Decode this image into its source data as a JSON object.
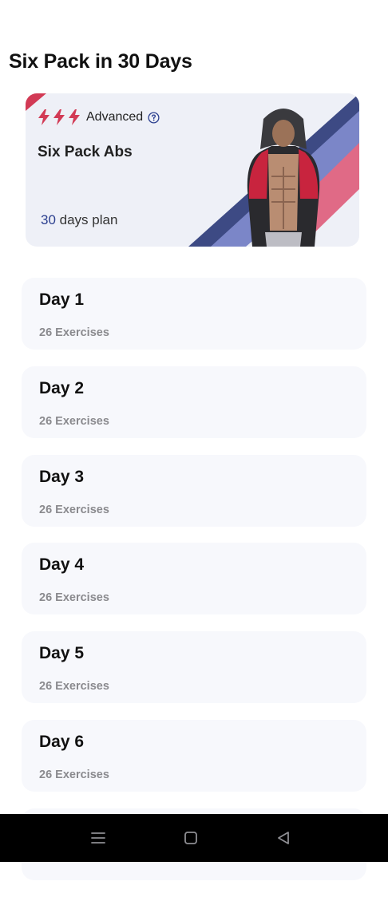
{
  "header": {
    "title": "Six Pack in 30 Days"
  },
  "plan_card": {
    "level_label": "Advanced",
    "level_icons": [
      "bolt-icon",
      "bolt-icon",
      "bolt-icon"
    ],
    "level_color": "#d23a55",
    "name": "Six Pack Abs",
    "days_number": "30",
    "days_suffix": " days plan"
  },
  "days": [
    {
      "title": "Day 1",
      "subtitle": "26 Exercises"
    },
    {
      "title": "Day 2",
      "subtitle": "26 Exercises"
    },
    {
      "title": "Day 3",
      "subtitle": "26 Exercises"
    },
    {
      "title": "Day 4",
      "subtitle": "26 Exercises"
    },
    {
      "title": "Day 5",
      "subtitle": "26 Exercises"
    },
    {
      "title": "Day 6",
      "subtitle": "26 Exercises"
    },
    {
      "title": "",
      "subtitle": ""
    }
  ],
  "nav": {
    "icons": [
      "menu-icon",
      "home-square-icon",
      "back-triangle-icon"
    ]
  },
  "colors": {
    "accent_red": "#d23a55",
    "accent_blue": "#2b3f8f",
    "card_bg": "#f7f8fc"
  }
}
